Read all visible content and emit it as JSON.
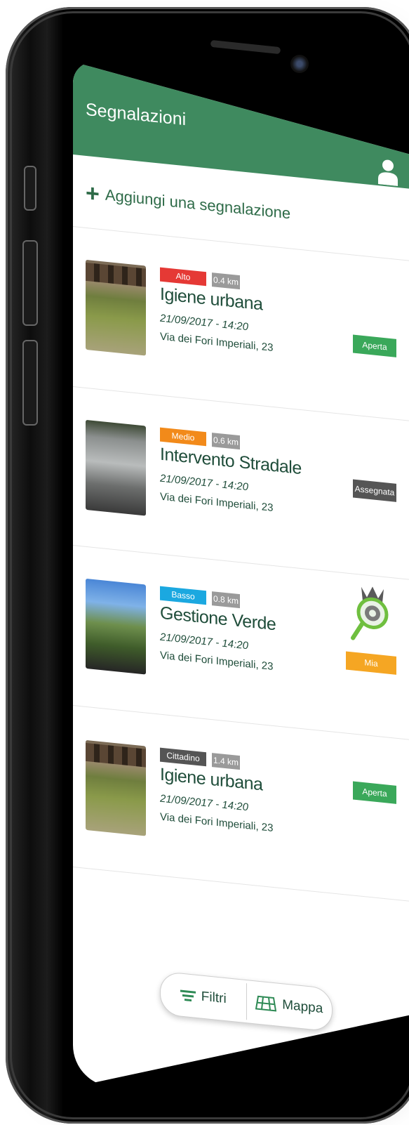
{
  "header": {
    "title": "Segnalazioni",
    "user_icon": "user-icon"
  },
  "add": {
    "icon": "plus-icon",
    "label": "Aggiungi una segnalazione"
  },
  "reports": [
    {
      "priority": "Alto",
      "priority_color": "#e53935",
      "distance": "0.4 km",
      "title": "Igiene urbana",
      "datetime": "21/09/2017 - 14:20",
      "address": "Via dei Fori Imperiali, 23",
      "status": "Aperta",
      "status_color": "#3aa85a",
      "thumb": "ruins-photo"
    },
    {
      "priority": "Medio",
      "priority_color": "#f28a1a",
      "distance": "0.6 km",
      "title": "Intervento Stradale",
      "datetime": "21/09/2017 - 14:20",
      "address": "Via dei Fori Imperiali, 23",
      "status": "Assegnata",
      "status_color": "#555555",
      "thumb": "pothole-photo"
    },
    {
      "priority": "Basso",
      "priority_color": "#1ba8e0",
      "distance": "0.8 km",
      "title": "Gestione Verde",
      "datetime": "21/09/2017 - 14:20",
      "address": "Via dei Fori Imperiali, 23",
      "status": "Mia",
      "status_color": "#f5a623",
      "thumb": "fallen-tree-photo",
      "extra_icon": "magnifier-logo-icon"
    },
    {
      "priority": "Cittadino",
      "priority_color": "#555555",
      "distance": "1.4 km",
      "title": "Igiene urbana",
      "datetime": "21/09/2017 - 14:20",
      "address": "Via dei Fori Imperiali, 23",
      "status": "Aperta",
      "status_color": "#3aa85a",
      "thumb": "ruins-photo"
    }
  ],
  "bottom_bar": {
    "filters_label": "Filtri",
    "filters_icon": "filter-icon",
    "map_label": "Mappa",
    "map_icon": "map-icon"
  },
  "colors": {
    "brand_green": "#3f8a5f",
    "text_dark": "#1f4d3a"
  }
}
